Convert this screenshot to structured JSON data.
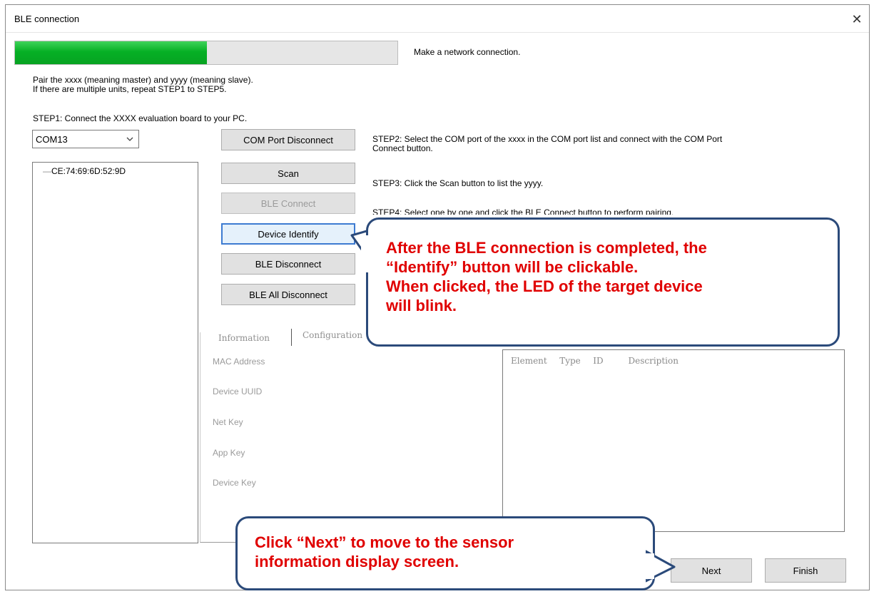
{
  "window": {
    "title": "BLE connection",
    "close_glyph": "✕"
  },
  "progress": {
    "percent": 50,
    "status_text": "Make a network connection."
  },
  "intro": {
    "line1": "Pair the xxxx (meaning master) and yyyy (meaning slave).",
    "line2": "If there are multiple units, repeat STEP1 to STEP5."
  },
  "steps": {
    "step1": "STEP1: Connect the XXXX evaluation board to your PC.",
    "step2_line1": "STEP2: Select the COM port of the xxxx in the COM port list and connect with the COM Port",
    "step2_line2": "Connect button.",
    "step3": "STEP3: Click the Scan button to list the yyyy.",
    "step4_partial": "STEP4: Select one by one and click the BLE Connect button to perform pairing."
  },
  "com_port": {
    "selected": "COM13"
  },
  "device_list": {
    "items": [
      "CE:74:69:6D:52:9D"
    ]
  },
  "buttons": {
    "com_port_disconnect": "COM Port Disconnect",
    "scan": "Scan",
    "ble_connect": "BLE Connect",
    "device_identify": "Device Identify",
    "ble_disconnect": "BLE Disconnect",
    "ble_all_disconnect": "BLE All Disconnect",
    "next": "Next",
    "finish": "Finish"
  },
  "tabs": {
    "information": "Information",
    "configuration": "Configuration"
  },
  "info_fields": {
    "mac_address": "MAC Address",
    "device_uuid": "Device UUID",
    "net_key": "Net Key",
    "app_key": "App Key",
    "device_key": "Device Key"
  },
  "element_list": {
    "headers": [
      "Element",
      "Type",
      "ID",
      "Description"
    ]
  },
  "callouts": {
    "identify": {
      "line1": "After the BLE connection is completed, the",
      "line2": "“Identify” button will be clickable.",
      "line3": "When clicked, the LED of the target device",
      "line4": "will blink."
    },
    "next": {
      "line1": "Click “Next” to move to the sensor",
      "line2": "information display screen."
    }
  },
  "colors": {
    "progress_fill": "#06b025",
    "callout_text": "#e00000",
    "callout_border": "#2b4a7a"
  },
  "icons": {
    "close": "close-icon",
    "dropdown": "chevron-down-icon"
  }
}
